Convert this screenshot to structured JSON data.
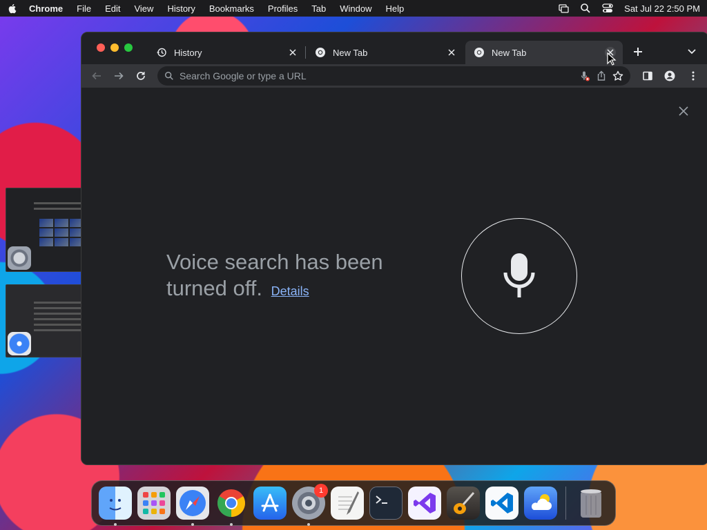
{
  "menubar": {
    "app_name": "Chrome",
    "items": [
      "File",
      "Edit",
      "View",
      "History",
      "Bookmarks",
      "Profiles",
      "Tab",
      "Window",
      "Help"
    ],
    "datetime": "Sat Jul 22  2:50 PM"
  },
  "tabs": [
    {
      "title": "History",
      "icon": "history-icon",
      "active": false
    },
    {
      "title": "New Tab",
      "icon": "chrome-icon",
      "active": false
    },
    {
      "title": "New Tab",
      "icon": "chrome-icon",
      "active": true
    }
  ],
  "omnibox": {
    "placeholder": "Search Google or type a URL"
  },
  "voice": {
    "message": "Voice search has been turned off.",
    "details_link": "Details"
  },
  "dock": {
    "apps": [
      {
        "name": "Finder",
        "running": true
      },
      {
        "name": "Launchpad",
        "running": false
      },
      {
        "name": "Safari",
        "running": true
      },
      {
        "name": "Chrome",
        "running": true
      },
      {
        "name": "App Store",
        "running": false
      },
      {
        "name": "System Settings",
        "running": true,
        "badge": "1"
      },
      {
        "name": "TextEdit",
        "running": false
      },
      {
        "name": "Terminal",
        "running": false
      },
      {
        "name": "Visual Studio",
        "running": false
      },
      {
        "name": "GarageBand",
        "running": false
      },
      {
        "name": "VS Code",
        "running": false
      },
      {
        "name": "Weather",
        "running": false
      }
    ]
  },
  "colors": {
    "chrome_bg": "#202124",
    "toolbar_bg": "#35363a",
    "link": "#8ab4f8",
    "text_muted": "#9aa0a6"
  }
}
